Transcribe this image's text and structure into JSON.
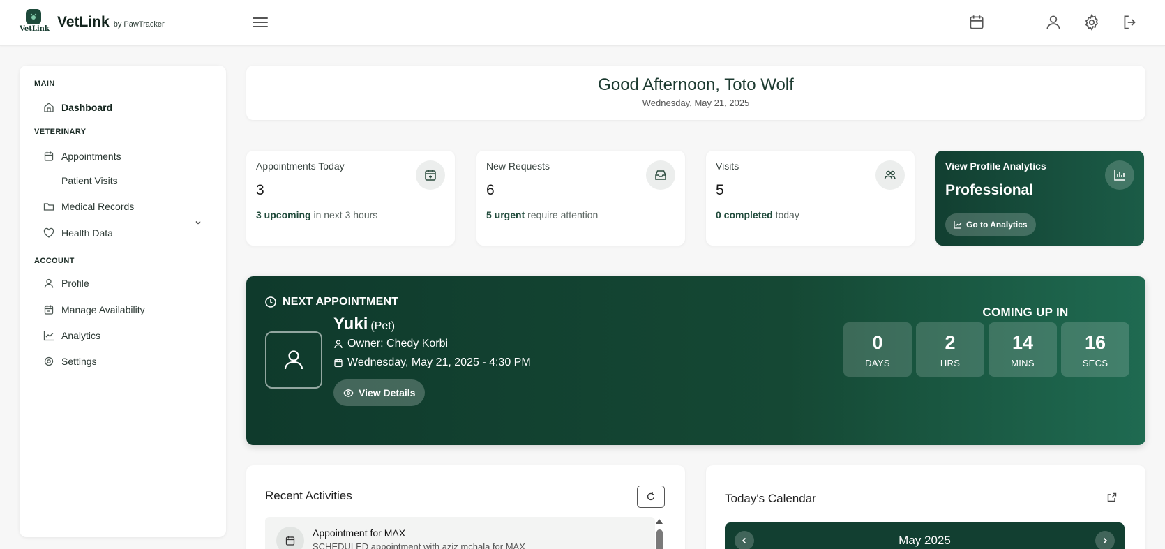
{
  "app": {
    "logo_text": "VetLink",
    "brand_name": "VetLink",
    "brand_sub": "by PawTracker"
  },
  "topbar_icons": [
    "menu-icon",
    "calendar-icon",
    "user-icon",
    "gear-icon",
    "logout-icon"
  ],
  "sidebar": {
    "sections": {
      "main": "MAIN",
      "veterinary": "VETERINARY",
      "account": "ACCOUNT"
    },
    "items": [
      {
        "label": "Dashboard",
        "icon": "home-icon"
      },
      {
        "label": "Appointments",
        "icon": "calendar-icon"
      },
      {
        "label": "Patient Visits",
        "icon": ""
      },
      {
        "label": "Medical Records",
        "icon": "folder-icon"
      },
      {
        "label": "Health Data",
        "icon": "heart-icon"
      },
      {
        "label": "Profile",
        "icon": "user-icon"
      },
      {
        "label": "Manage Availability",
        "icon": "calendar-check-icon"
      },
      {
        "label": "Analytics",
        "icon": "line-chart-icon"
      },
      {
        "label": "Settings",
        "icon": "gear-icon"
      }
    ]
  },
  "greeting": {
    "title": "Good Afternoon, Toto Wolf",
    "date": "Wednesday, May 21, 2025"
  },
  "stats": [
    {
      "label": "Appointments Today",
      "value": "3",
      "foot_bold": "3 upcoming",
      "foot_rest": " in next 3 hours",
      "icon": "calendar-add-icon"
    },
    {
      "label": "New Requests",
      "value": "6",
      "foot_bold": "5 urgent",
      "foot_rest": " require attention",
      "icon": "inbox-icon"
    },
    {
      "label": "Visits",
      "value": "5",
      "foot_bold": "0 completed",
      "foot_rest": " today",
      "icon": "users-icon"
    }
  ],
  "profile_card": {
    "label": "View Profile Analytics",
    "tier": "Professional",
    "button": "Go to Analytics",
    "icon": "bar-chart-icon"
  },
  "next_appointment": {
    "header": "NEXT APPOINTMENT",
    "pet_name": "Yuki",
    "pet_tag": "(Pet)",
    "owner": "Owner: Chedy Korbi",
    "datetime": "Wednesday, May 21, 2025 - 4:30 PM",
    "button": "View Details",
    "coming_up": "COMING UP IN",
    "countdown": [
      {
        "value": "0",
        "label": "DAYS"
      },
      {
        "value": "2",
        "label": "HRS"
      },
      {
        "value": "14",
        "label": "MINS"
      },
      {
        "value": "16",
        "label": "SECS"
      }
    ]
  },
  "recent": {
    "title": "Recent Activities",
    "items": [
      {
        "title": "Appointment for MAX",
        "subtitle": "SCHEDULED appointment with aziz mchala for MAX"
      }
    ]
  },
  "calendar": {
    "title": "Today's Calendar",
    "month": "May 2025"
  },
  "colors": {
    "brand_dark": "#123f31",
    "brand_mid": "#1b5c47",
    "accent_text": "#1f4a3a"
  }
}
